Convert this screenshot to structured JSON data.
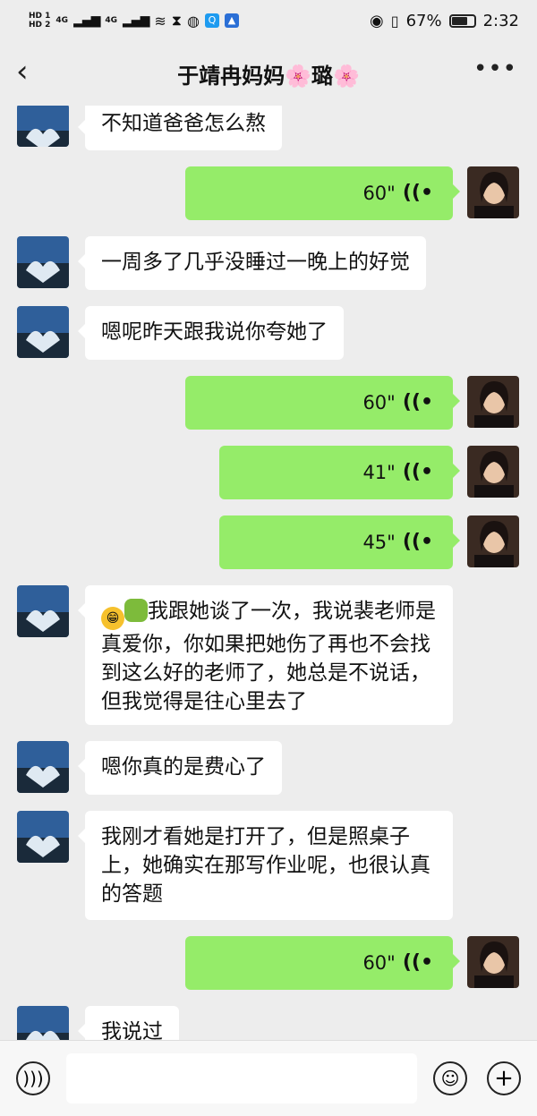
{
  "status": {
    "hd1": "HD 1",
    "hd2": "HD 2",
    "net1": "4G",
    "net2": "4G",
    "battery": "67%",
    "time": "2:32"
  },
  "header": {
    "title": "于靖冉妈妈🌸璐🌸"
  },
  "messages": [
    {
      "text": "不知道爸爸怎么熬"
    },
    {
      "duration": "60\""
    },
    {
      "text": "一周多了几乎没睡过一晚上的好觉"
    },
    {
      "text": "嗯呢昨天跟我说你夸她了"
    },
    {
      "duration": "60\""
    },
    {
      "duration": "41\""
    },
    {
      "duration": "45\""
    },
    {
      "text": "我跟她谈了一次，我说裴老师是真爱你，你如果把她伤了再也不会找到这么好的老师了，她总是不说话，但我觉得是往心里去了"
    },
    {
      "text": "嗯你真的是费心了"
    },
    {
      "text": "我刚才看她是打开了，但是照桌子上，她确实在那写作业呢，也很认真的答题"
    },
    {
      "duration": "60\""
    },
    {
      "text": "我说过"
    }
  ],
  "colors": {
    "out_bubble": "#95ec69",
    "in_bubble": "#ffffff",
    "background": "#ededed"
  },
  "icons": {
    "back": "back-arrow-icon",
    "more": "more-icon",
    "voice": "voice-icon",
    "emoji": "emoji-icon",
    "add": "add-icon"
  }
}
